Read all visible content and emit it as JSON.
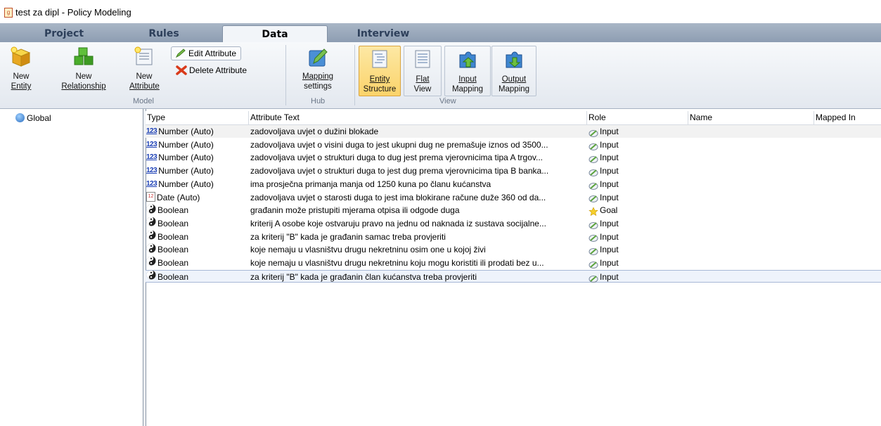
{
  "window": {
    "title": "test za dipl - Policy Modeling"
  },
  "tabs": [
    {
      "label": "Project",
      "active": false
    },
    {
      "label": "Rules",
      "active": false
    },
    {
      "label": "Data",
      "active": true
    },
    {
      "label": "Interview",
      "active": false
    }
  ],
  "ribbon": {
    "model": {
      "group_label": "Model",
      "new_entity": [
        "New",
        "Entity"
      ],
      "new_relationship": [
        "New",
        "Relationship"
      ],
      "new_attribute": [
        "New",
        "Attribute"
      ],
      "edit_attribute": "Edit Attribute",
      "delete_attribute": "Delete Attribute"
    },
    "hub": {
      "group_label": "Hub",
      "mapping_settings": [
        "Mapping",
        "settings"
      ]
    },
    "view": {
      "group_label": "View",
      "entity_structure": [
        "Entity",
        "Structure"
      ],
      "flat_view": [
        "Flat",
        "View"
      ],
      "input_mapping": [
        "Input",
        "Mapping"
      ],
      "output_mapping": [
        "Output",
        "Mapping"
      ]
    }
  },
  "tree": {
    "items": [
      {
        "label": "Global",
        "icon": "globe-icon"
      }
    ]
  },
  "grid": {
    "columns": [
      "Type",
      "Attribute Text",
      "Role",
      "Name",
      "Mapped In"
    ],
    "rows": [
      {
        "type": "Number (Auto)",
        "icon": "number-icon",
        "text": "zadovoljava uvjet o dužini blokade",
        "role": "Input",
        "role_icon": "input-icon"
      },
      {
        "type": "Number (Auto)",
        "icon": "number-icon",
        "text": "zadovoljava uvjet o visini duga to jest ukupni dug ne premašuje iznos od 3500...",
        "role": "Input",
        "role_icon": "input-icon"
      },
      {
        "type": "Number (Auto)",
        "icon": "number-icon",
        "text": "zadovoljava uvjet o strukturi duga to dug jest prema vjerovnicima tipa A trgov...",
        "role": "Input",
        "role_icon": "input-icon"
      },
      {
        "type": "Number (Auto)",
        "icon": "number-icon",
        "text": "zadovoljava uvjet o strukturi duga to jest dug prema vjerovnicima tipa B banka...",
        "role": "Input",
        "role_icon": "input-icon"
      },
      {
        "type": "Number (Auto)",
        "icon": "number-icon",
        "text": "ima prosječna primanja manja od 1250 kuna po članu kućanstva",
        "role": "Input",
        "role_icon": "input-icon"
      },
      {
        "type": "Date (Auto)",
        "icon": "calendar-icon",
        "text": "zadovoljava uvjet o starosti duga to jest ima blokirane račune duže 360 od da...",
        "role": "Input",
        "role_icon": "input-icon"
      },
      {
        "type": "Boolean",
        "icon": "boolean-icon",
        "text": "građanin može pristupiti mjerama otpisa ili odgode duga",
        "role": "Goal",
        "role_icon": "goal-star-icon"
      },
      {
        "type": "Boolean",
        "icon": "boolean-icon",
        "text": "kriterij A osobe koje ostvaruju pravo na jednu od naknada iz sustava socijalne...",
        "role": "Input",
        "role_icon": "input-icon"
      },
      {
        "type": "Boolean",
        "icon": "boolean-icon",
        "text": "za kriterij \"B\" kada je građanin samac treba provjeriti",
        "role": "Input",
        "role_icon": "input-icon"
      },
      {
        "type": "Boolean",
        "icon": "boolean-icon",
        "text": "koje nemaju u vlasništvu drugu nekretninu osim one u kojoj živi",
        "role": "Input",
        "role_icon": "input-icon"
      },
      {
        "type": "Boolean",
        "icon": "boolean-icon",
        "text": "koje nemaju u vlasništvu drugu nekretninu koju mogu koristiti ili prodati bez u...",
        "role": "Input",
        "role_icon": "input-icon"
      },
      {
        "type": "Boolean",
        "icon": "boolean-icon",
        "text": "za kriterij \"B\" kada je građanin član kućanstva treba provjeriti",
        "role": "Input",
        "role_icon": "input-icon"
      }
    ]
  }
}
